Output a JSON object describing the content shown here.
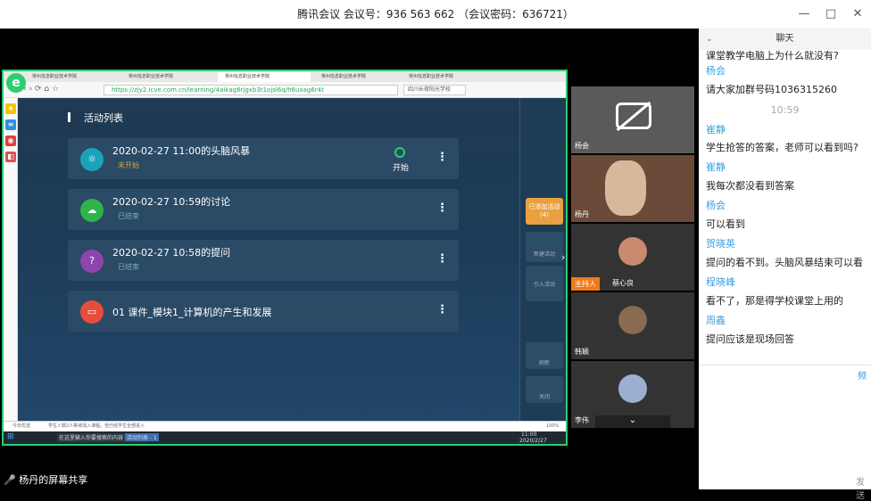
{
  "titlebar": {
    "title": "腾讯会议 会议号：936 563 662 （会议密码：636721）",
    "min": "—",
    "max": "□",
    "close": "✕"
  },
  "browser": {
    "tabs": [
      "常州信息职业技术学院",
      "常州信息职业技术学院",
      "常州信息职业技术学院",
      "常州信息职业技术学院",
      "常州信息职业技术学院"
    ],
    "url": "https://zjy2.icve.com.cn/learning/4aikag6rjgxb3t1ojsl6q/h6uxag6r4t",
    "search_placeholder": "四川长荷阳光学校",
    "status_left": "今日优选",
    "status_mid": "学生人数2人等待加入课程，但已经学生全部进入",
    "status_right": "100%"
  },
  "course": {
    "heading": "活动列表",
    "activities": [
      {
        "title": "2020-02-27 11:00的头脑风暴",
        "status": "未开始",
        "action": "开始",
        "icon": "lightbulb-icon",
        "icon_glyph": "☼",
        "icon_color": "#1aa3b8",
        "status_color": "#e0a030"
      },
      {
        "title": "2020-02-27 10:59的讨论",
        "status": "已结束",
        "icon": "chat-bubble-icon",
        "icon_glyph": "☁",
        "icon_color": "#2fb44a",
        "status_color": "#7fa8c8"
      },
      {
        "title": "2020-02-27 10:58的提问",
        "status": "已结束",
        "icon": "question-icon",
        "icon_glyph": "?",
        "icon_color": "#8e44ad",
        "status_color": "#7fa8c8"
      },
      {
        "title": "01 课件_模块1_计算机的产生和发展",
        "icon": "folder-icon",
        "icon_glyph": "▭",
        "icon_color": "#e74c3c"
      }
    ],
    "side_buttons": {
      "added": "已添加活动",
      "added_count": "(4)",
      "new": "新建活动",
      "import": "引入活动",
      "refresh": "刷新",
      "close": "关闭"
    },
    "more_glyph": "⋮"
  },
  "taskbar": {
    "time": "11:00",
    "date": "2020/2/27",
    "app_label": "活动列表 - 1",
    "search": "在这里输入你要搜索的内容"
  },
  "share_label": "杨丹的屏幕共享",
  "participants": [
    {
      "name": "杨会",
      "camera_off": true
    },
    {
      "name": "杨丹"
    },
    {
      "name": "蔡心良",
      "host_badge": "主持人"
    },
    {
      "name": "韩颖"
    },
    {
      "name": "李伟"
    }
  ],
  "chat": {
    "header": "聊天",
    "messages": [
      {
        "type": "msg",
        "text": "课堂教学电脑上为什么就没有?"
      },
      {
        "type": "name",
        "text": "杨会"
      },
      {
        "type": "msg",
        "text": "请大家加群号码1036315260"
      },
      {
        "type": "time",
        "text": "10:59"
      },
      {
        "type": "name",
        "text": "崔静"
      },
      {
        "type": "msg",
        "text": "学生抢答的答案，老师可以看到吗?"
      },
      {
        "type": "name",
        "text": "崔静"
      },
      {
        "type": "msg",
        "text": "我每次都没看到答案"
      },
      {
        "type": "name",
        "text": "杨会"
      },
      {
        "type": "msg",
        "text": "可以看到"
      },
      {
        "type": "name",
        "text": "贺晓英"
      },
      {
        "type": "msg",
        "text": "提问的看不到。头脑风暴结束可以看"
      },
      {
        "type": "name",
        "text": "程晓峰"
      },
      {
        "type": "msg",
        "text": "看不了，那是得学校课堂上用的"
      },
      {
        "type": "name",
        "text": "周鑫"
      },
      {
        "type": "msg",
        "text": "提问应该是现场回答"
      }
    ],
    "send": "发送",
    "side": "频"
  }
}
